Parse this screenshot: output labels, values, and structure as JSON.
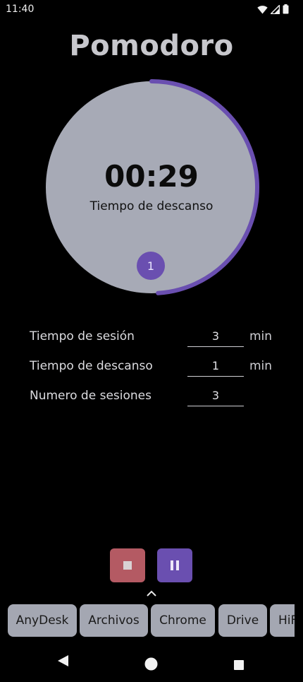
{
  "status": {
    "time": "11:40",
    "icons": [
      "wifi-icon",
      "signal-icon",
      "battery-icon"
    ]
  },
  "app": {
    "title": "Pomodoro"
  },
  "timer": {
    "time": "00:29",
    "label": "Tiempo de descanso",
    "session": "1",
    "progress": 0.49
  },
  "settings": [
    {
      "label": "Tiempo de sesión",
      "value": "3",
      "unit": "min"
    },
    {
      "label": "Tiempo de descanso",
      "value": "1",
      "unit": "min"
    },
    {
      "label": "Numero de sesiones",
      "value": "3",
      "unit": ""
    }
  ],
  "controls": {
    "stop": "stop-icon",
    "pause": "pause-icon"
  },
  "taskbar": {
    "apps": [
      "AnyDesk",
      "Archivos",
      "Chrome",
      "Drive",
      "HiF"
    ]
  },
  "nav": {
    "icons": [
      "back-icon",
      "home-icon",
      "recents-icon"
    ]
  },
  "colors": {
    "accent": "#6a4fb0",
    "dial": "#a7aab6",
    "stop": "#b45a63",
    "chip": "#a4a7b2"
  }
}
